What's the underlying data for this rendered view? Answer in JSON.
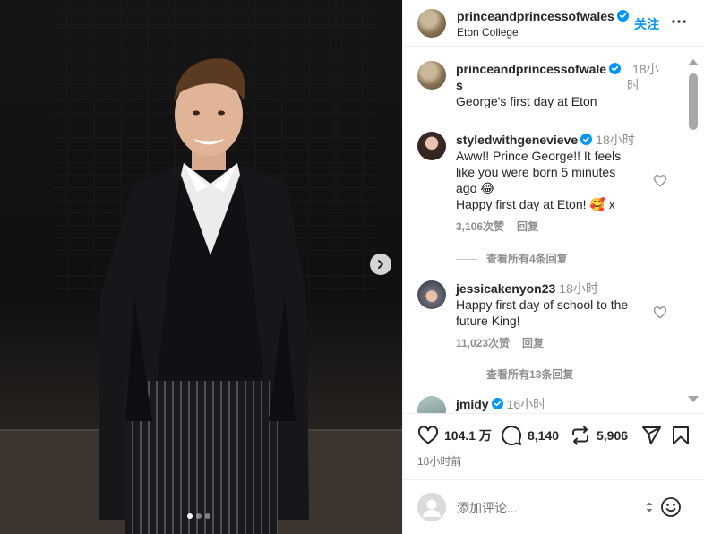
{
  "header": {
    "username": "princeandprincessofwales",
    "location": "Eton College",
    "follow_label": "关注"
  },
  "caption": {
    "username": "princeandprincessofwale",
    "username_wrap": "s",
    "time": "18小",
    "time_wrap": "时",
    "text": "George's first day at Eton"
  },
  "comments": [
    {
      "username": "styledwithgenevieve",
      "verified": true,
      "time": "18小时",
      "lines": [
        "Aww!! Prince George!! It feels",
        "like you were born 5 minutes",
        "ago 😂",
        "Happy first day at Eton! 🥰 x"
      ],
      "likes": "3,106次赞",
      "reply": "回复",
      "view_replies": "查看所有4条回复"
    },
    {
      "username": "jessicakenyon23",
      "verified": false,
      "time": "18小时",
      "lines": [
        "Happy first day of school to the",
        "future King!"
      ],
      "likes": "11,023次赞",
      "reply": "回复",
      "view_replies": "查看所有13条回复"
    },
    {
      "username": "jmidy",
      "verified": true,
      "time": "16小时"
    }
  ],
  "actions": {
    "likes": "104.1 万",
    "comments": "8,140",
    "reposts": "5,906",
    "time_ago": "18小时前"
  },
  "add_comment": {
    "placeholder": "添加评论..."
  },
  "carousel": {
    "current": 1,
    "total": 3
  },
  "icons": {
    "verified": "verified-badge-icon",
    "more": "more-horizontal-icon",
    "like": "heart-icon",
    "comment": "comment-icon",
    "repost": "repost-icon",
    "share": "send-icon",
    "save": "bookmark-icon",
    "emoji": "emoji-icon",
    "next": "chevron-right-icon"
  },
  "colors": {
    "accent": "#0095f6",
    "verified": "#0095f6",
    "muted": "#8e8e8e"
  }
}
